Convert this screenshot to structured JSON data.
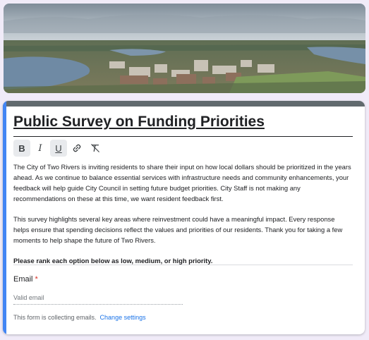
{
  "form": {
    "title": "Public Survey on Funding Priorities",
    "description_paragraphs": [
      "The City of Two Rivers is inviting residents to share their input on how local dollars should be prioritized in the years ahead. As we continue to balance essential services with infrastructure needs and community enhancements, your feedback will help guide City Council in setting future budget priorities. City Staff is not making any recommendations on these at this time, we want resident feedback first.",
      "This survey highlights several key areas where reinvestment could have a meaningful impact. Every response helps ensure that spending decisions reflect the values and priorities of our residents. Thank you for taking a few moments to help shape the future of Two Rivers."
    ],
    "instruction": "Please rank each option below as low, medium, or high priority.",
    "toolbar": {
      "bold": "B",
      "italic": "I",
      "underline": "U",
      "link_icon": "link-icon",
      "clear_format_icon": "clear-format-icon"
    },
    "email": {
      "label": "Email",
      "required_marker": "*",
      "placeholder": "Valid email"
    },
    "collecting_notice": "This form is collecting emails.",
    "change_settings_label": "Change settings"
  },
  "colors": {
    "accent": "#4285f4",
    "header_bar": "#616a6e",
    "background": "#f0ebf8",
    "required": "#d93025",
    "link": "#1a73e8"
  }
}
